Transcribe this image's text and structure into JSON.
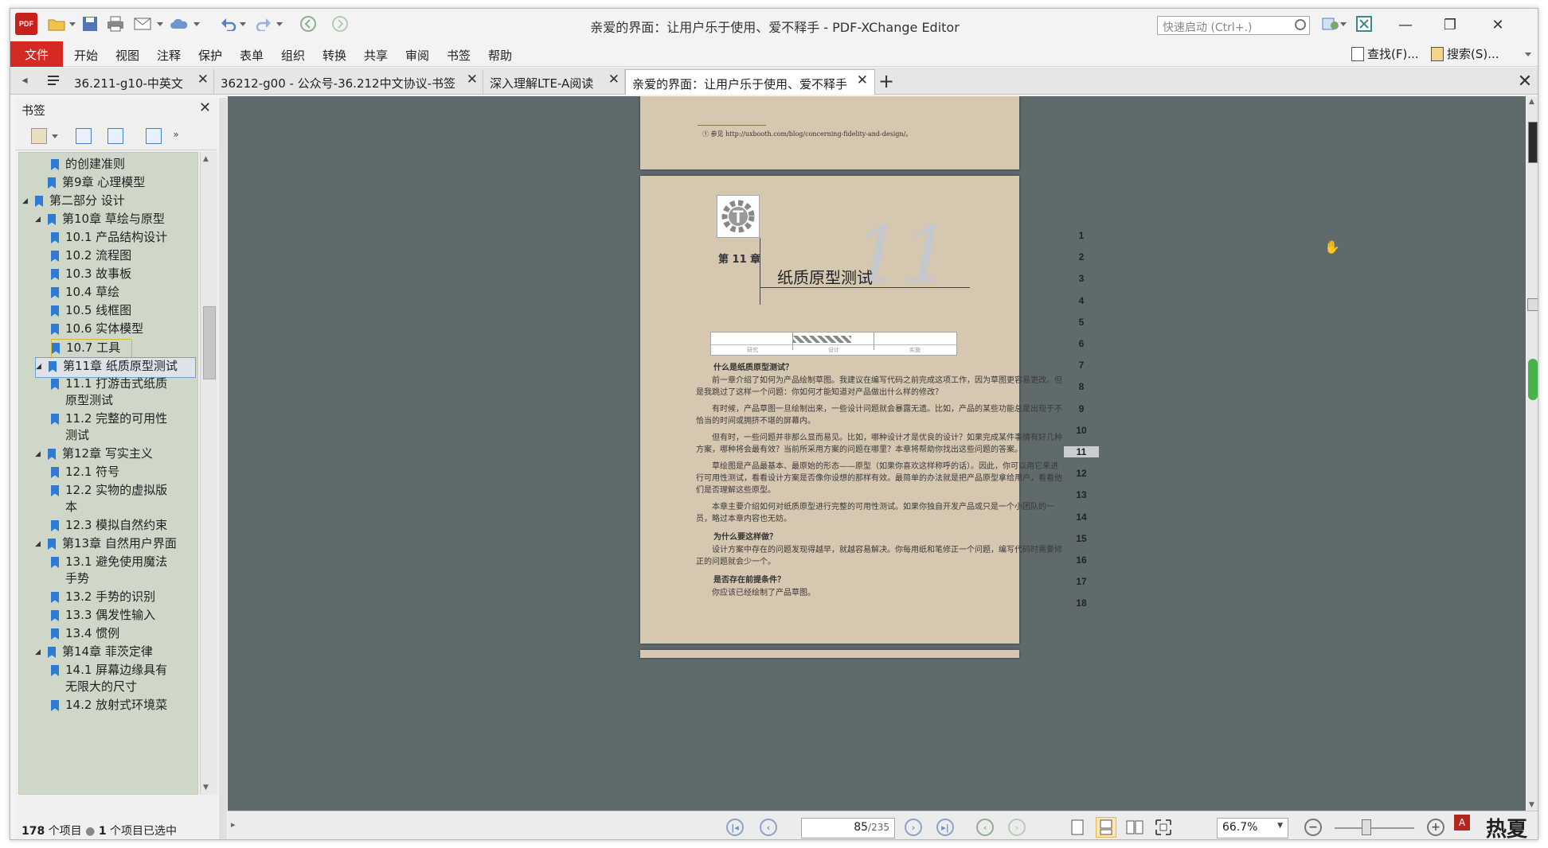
{
  "app": {
    "title": "亲爱的界面：让用户乐于使用、爱不释手 - PDF-XChange Editor",
    "logo_text": "PDF",
    "quick_launch_placeholder": "快速启动 (Ctrl+.)"
  },
  "menu": {
    "file": "文件",
    "items": [
      "开始",
      "视图",
      "注释",
      "保护",
      "表单",
      "组织",
      "转换",
      "共享",
      "审阅",
      "书签",
      "帮助"
    ],
    "find": "查找(F)...",
    "search": "搜索(S)..."
  },
  "tabs": [
    {
      "label": "36.211-g10-中英文"
    },
    {
      "label": "36212-g00 - 公众号-36.212中文协议-书签"
    },
    {
      "label": "深入理解LTE-A阅读"
    },
    {
      "label": "亲爱的界面：让用户乐于使用、爱不释手"
    }
  ],
  "bookmarks": {
    "title": "书签",
    "items": [
      {
        "label": "的创建准则",
        "level": 3
      },
      {
        "label": "第9章  心理模型",
        "level": 2
      },
      {
        "label": "第二部分  设计",
        "level": 1
      },
      {
        "label": "第10章  草绘与原型",
        "level": 2
      },
      {
        "label": "10.1    产品结构设计",
        "level": 3
      },
      {
        "label": "10.2    流程图",
        "level": 3
      },
      {
        "label": "10.3    故事板",
        "level": 3
      },
      {
        "label": "10.4    草绘",
        "level": 3
      },
      {
        "label": "10.5    线框图",
        "level": 3
      },
      {
        "label": "10.6    实体模型",
        "level": 3
      },
      {
        "label": "10.7    工具",
        "level": 3
      },
      {
        "label": "第11章  纸质原型测试",
        "level": 2
      },
      {
        "label": "11.1    打游击式纸质",
        "label2": "原型测试",
        "level": 3
      },
      {
        "label": "11.2    完整的可用性",
        "label2": "测试",
        "level": 3
      },
      {
        "label": "第12章  写实主义",
        "level": 2
      },
      {
        "label": "12.1    符号",
        "level": 3
      },
      {
        "label": "12.2    实物的虚拟版",
        "label2": "本",
        "level": 3
      },
      {
        "label": "12.3    模拟自然约束",
        "level": 3
      },
      {
        "label": "第13章  自然用户界面",
        "level": 2
      },
      {
        "label": "13.1    避免使用魔法",
        "label2": "手势",
        "level": 3
      },
      {
        "label": "13.2    手势的识别",
        "level": 3
      },
      {
        "label": "13.3    偶发性输入",
        "level": 3
      },
      {
        "label": "13.4    惯例",
        "level": 3
      },
      {
        "label": "第14章  菲茨定律",
        "level": 2
      },
      {
        "label": "14.1    屏幕边缘具有",
        "label2": "无限大的尺寸",
        "level": 3
      },
      {
        "label": "14.2    放射式环境菜",
        "level": 3
      }
    ],
    "status_count": "178",
    "status_count_label": "个项目",
    "status_selected": "1",
    "status_selected_label": "个项目已选中"
  },
  "pdf": {
    "footnote": "① 参见 http://uxbooth.com/blog/concerning-fidelity-and-design/。",
    "chapter_label": "第 11 章",
    "chapter_title": "纸质原型测试",
    "chapter_watermark": "11",
    "process_steps": [
      "研究",
      "设计",
      "实施"
    ],
    "sections": [
      {
        "type": "sub",
        "text": "什么是纸质原型测试？"
      },
      {
        "type": "para",
        "text": "前一章介绍了如何为产品绘制草图。我建议在编写代码之前完成这项工作，因为草图更容易更改。但是我跳过了这样一个问题：你如何才能知道对产品做出什么样的修改？"
      },
      {
        "type": "para",
        "text": "有时候，产品草图一旦绘制出来，一些设计问题就会暴露无遗。比如，产品的某些功能总是出现于不恰当的时间或拥挤不堪的屏幕内。"
      },
      {
        "type": "para",
        "text": "但有时，一些问题并非那么显而易见。比如，哪种设计才是优良的设计？如果完成某件事情有好几种方案，哪种将会最有效？当前所采用方案的问题在哪里？本章将帮助你找出这些问题的答案。"
      },
      {
        "type": "para",
        "text": "草绘图是产品最基本、最原始的形态——原型（如果你喜欢这样称呼的话）。因此，你可以用它来进行可用性测试，看看设计方案是否像你设想的那样有效。最简单的办法就是把产品原型拿给用户，看看他们是否理解这些原型。"
      },
      {
        "type": "para",
        "text": "本章主要介绍如何对纸质原型进行完整的可用性测试。如果你独自开发产品或只是一个小团队的一员，略过本章内容也无妨。"
      },
      {
        "type": "sub",
        "text": "为什么要这样做？"
      },
      {
        "type": "para",
        "text": "设计方案中存在的问题发现得越早，就越容易解决。你每用纸和笔修正一个问题，编写代码时需要修正的问题就会少一个。"
      },
      {
        "type": "sub",
        "text": "是否存在前提条件？"
      },
      {
        "type": "para",
        "text": "你应该已经绘制了产品草图。"
      }
    ],
    "line_numbers": [
      "1",
      "2",
      "3",
      "4",
      "5",
      "6",
      "7",
      "8",
      "9",
      "10",
      "11",
      "12",
      "13",
      "14",
      "15",
      "16",
      "17",
      "18"
    ],
    "highlight_line": "11"
  },
  "bottom": {
    "current_page": "85",
    "total_pages": "/235",
    "zoom": "66.7%"
  },
  "watermark_text": "热夏",
  "colors": {
    "accent": "#d42a23",
    "page_bg": "#d6c7b0",
    "canvas": "#5f6a6d",
    "bookmark_bg": "#cfd8c8"
  }
}
